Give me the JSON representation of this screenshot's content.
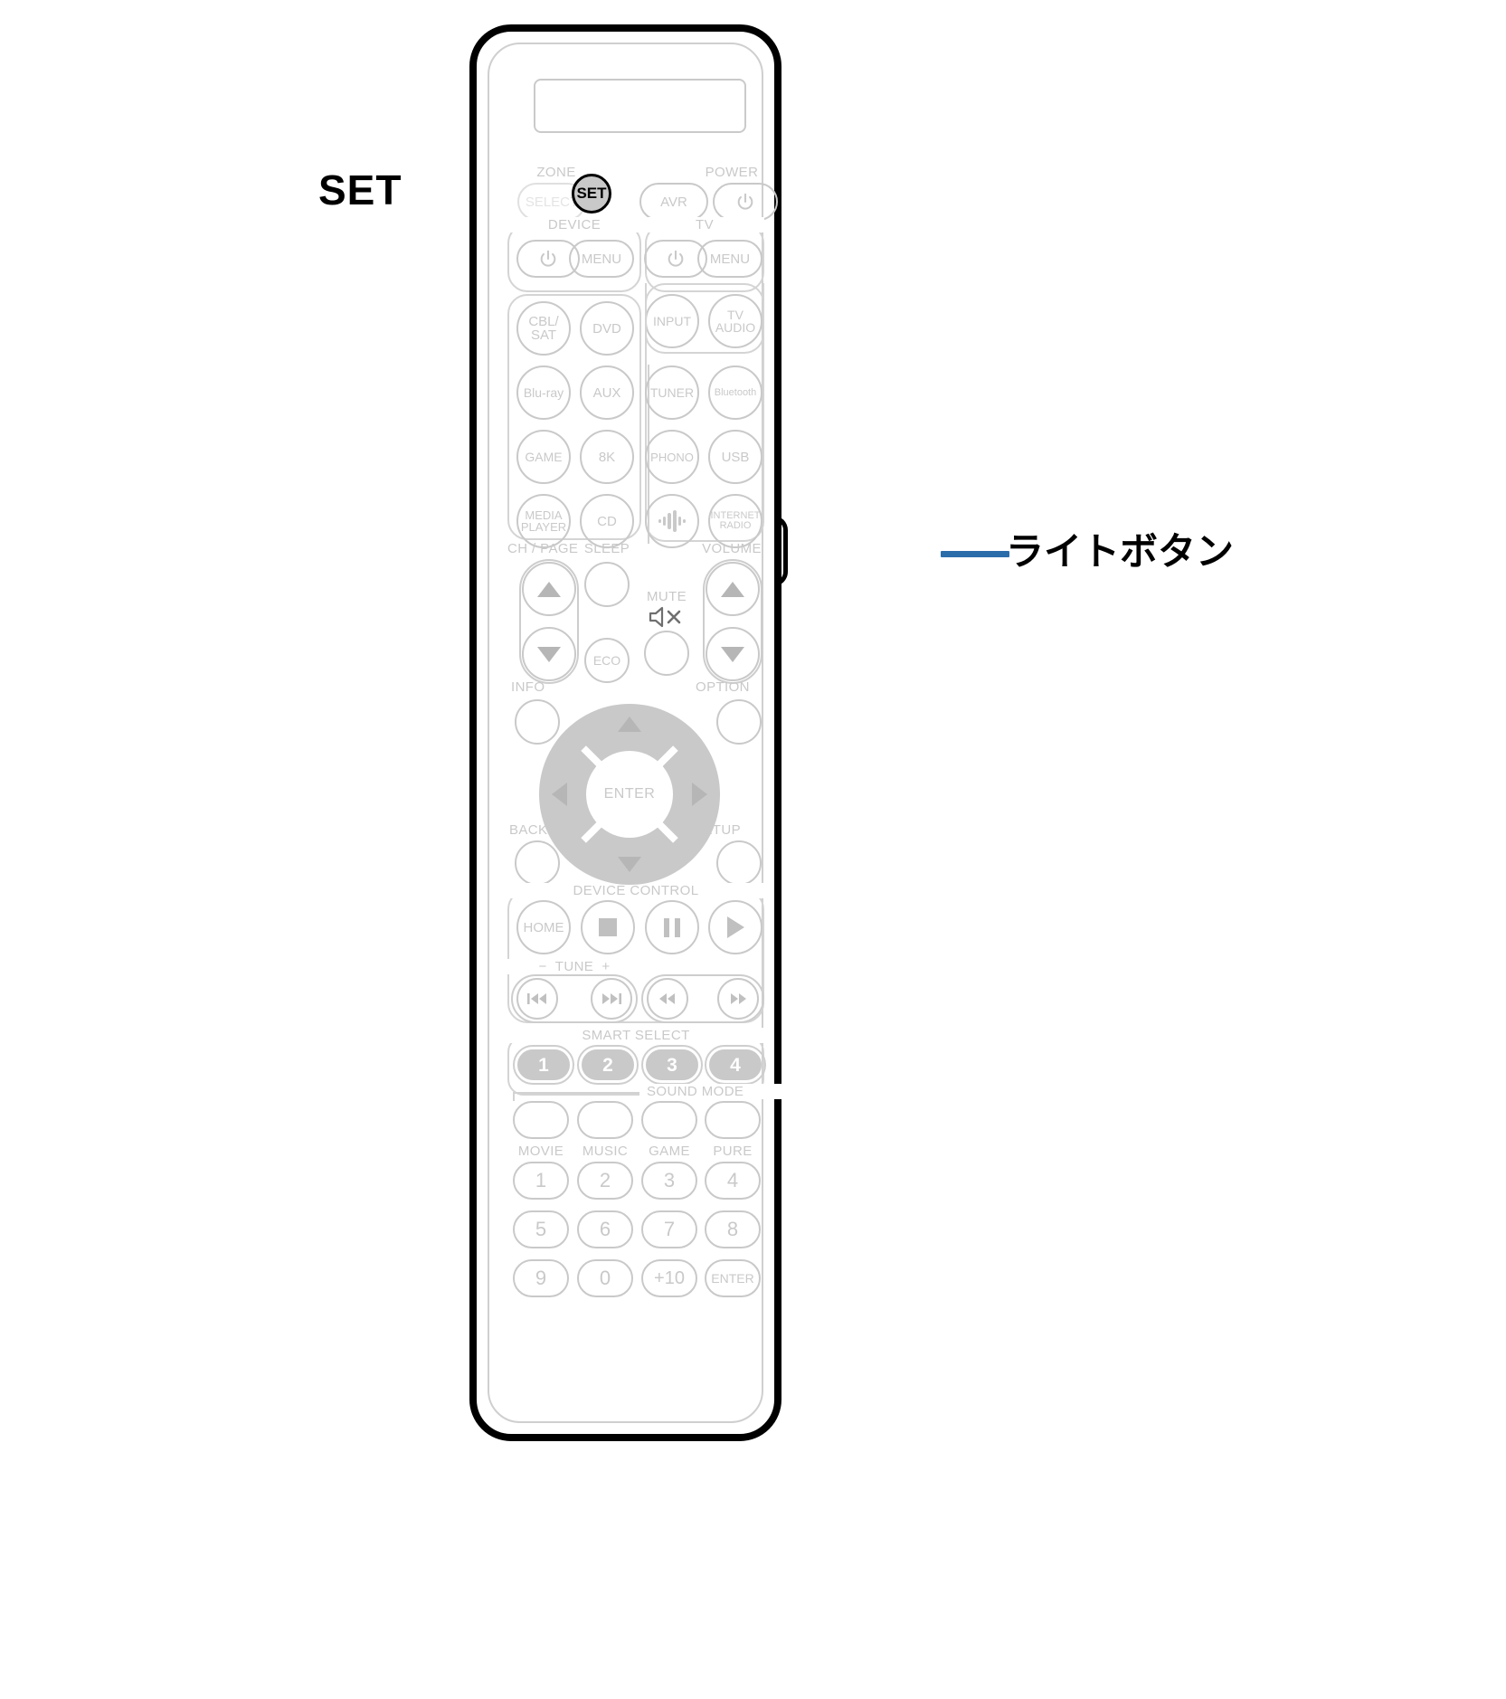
{
  "annotations": {
    "set": "SET",
    "light_button": "ライトボタン",
    "leader_color": "#2b6cab"
  },
  "remote": {
    "highlighted_button": "SET",
    "display_label": "",
    "sections": {
      "zone": {
        "label": "ZONE",
        "buttons": [
          "SELECT"
        ]
      },
      "power": {
        "label": "POWER",
        "buttons": [
          "AVR",
          "power-icon"
        ]
      },
      "device": {
        "label": "DEVICE",
        "buttons": [
          "power-icon",
          "MENU"
        ]
      },
      "tv": {
        "label": "TV",
        "buttons": [
          "power-icon",
          "MENU"
        ]
      },
      "tv_inputs": [
        "INPUT",
        "TV AUDIO"
      ],
      "input_left": [
        "CBL/ SAT",
        "DVD",
        "Blu-ray",
        "AUX",
        "GAME",
        "8K",
        "MEDIA PLAYER",
        "CD"
      ],
      "input_right": [
        "TUNER",
        "Bluetooth",
        "PHONO",
        "USB",
        "sound-wave-icon",
        "INTERNET RADIO"
      ],
      "ch_page": {
        "label": "CH / PAGE",
        "up": "▲",
        "down": "▼"
      },
      "sleep": {
        "label": "SLEEP",
        "eco": "ECO"
      },
      "mute": {
        "label": "MUTE",
        "icon": "mute-icon"
      },
      "volume": {
        "label": "VOLUME",
        "up": "▲",
        "down": "▼"
      },
      "info": "INFO",
      "option": "OPTION",
      "back": "BACK",
      "setup": "SETUP",
      "enter": "ENTER",
      "device_control": {
        "label": "DEVICE CONTROL",
        "buttons": [
          "HOME",
          "stop-icon",
          "pause-icon",
          "play-icon"
        ]
      },
      "tune": {
        "label": "TUNE",
        "minus": "−",
        "plus": "+",
        "buttons": [
          "skip-prev-icon",
          "skip-next-icon",
          "rewind-icon",
          "fast-forward-icon"
        ]
      },
      "smart_select": {
        "label": "SMART SELECT",
        "buttons": [
          "1",
          "2",
          "3",
          "4"
        ]
      },
      "sound_mode": {
        "label": "SOUND MODE",
        "buttons": [
          "MOVIE",
          "MUSIC",
          "GAME",
          "PURE"
        ]
      },
      "numpad": [
        "1",
        "2",
        "3",
        "4",
        "5",
        "6",
        "7",
        "8",
        "9",
        "0",
        "+10",
        "ENTER"
      ]
    }
  }
}
